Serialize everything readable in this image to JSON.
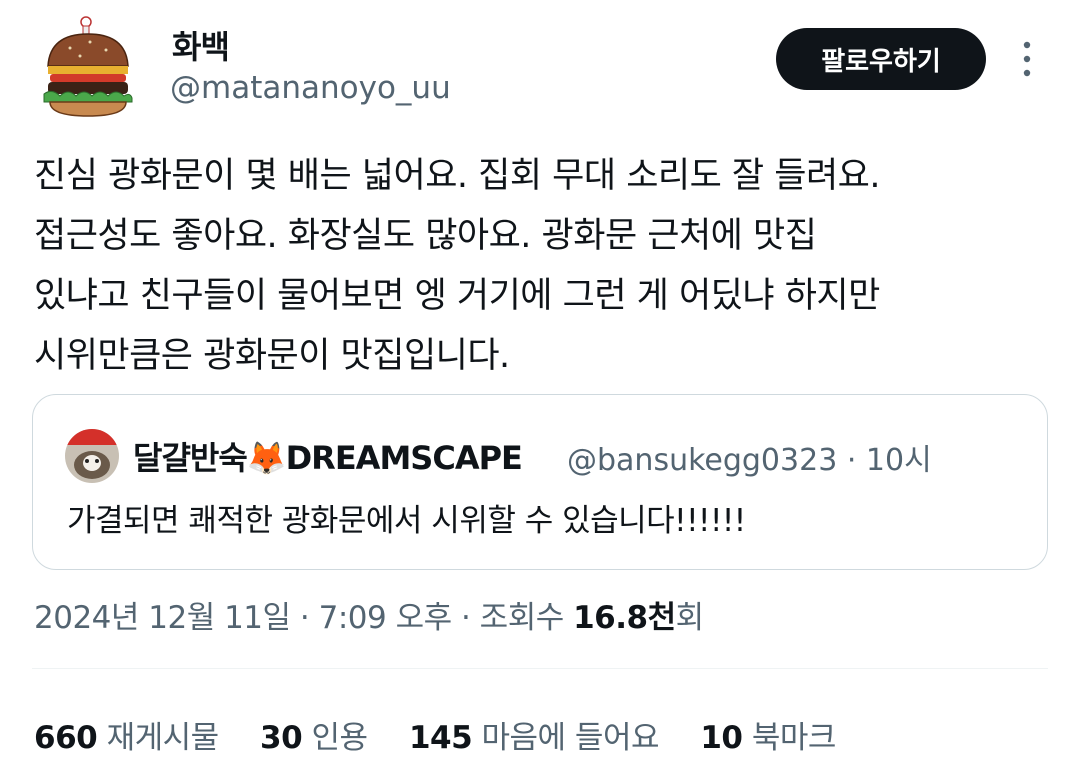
{
  "author": {
    "name": "화백",
    "handle": "@matananoyo_uu",
    "avatar_icon": "burger-icon"
  },
  "follow_label": "팔로우하기",
  "more_icon": "more-vertical-icon",
  "tweet": {
    "lines": [
      "진심 광화문이 몇 배는 넓어요. 집회 무대 소리도 잘 들려요.",
      "접근성도 좋아요. 화장실도 많아요. 광화문 근처에 맛집",
      "있냐고 친구들이 물어보면 엥 거기에 그런 게 어딨냐 하지만",
      "시위만큼은 광화문이 맛집입니다."
    ]
  },
  "quote": {
    "name": "달걀반숙",
    "emoji": "🦊",
    "name_suffix": "DREAMSCAPE",
    "handle": "@bansukegg0323",
    "time": "· 10시",
    "text": "가결되면 쾌적한 광화문에서 시위할 수 있습니다!!!!!!"
  },
  "timestamp": {
    "prefix": "2024년 12월 11일 · 7:09 오후 · 조회수 ",
    "views": "16.8천",
    "suffix": "회"
  },
  "stats": [
    {
      "count": "660",
      "label": "재게시물"
    },
    {
      "count": "30",
      "label": "인용"
    },
    {
      "count": "145",
      "label": "마음에 들어요"
    },
    {
      "count": "10",
      "label": "북마크"
    }
  ],
  "colors": {
    "text": "#0f1419",
    "secondary": "#536471",
    "border": "#cfd9de",
    "button_bg": "#0f1419"
  }
}
